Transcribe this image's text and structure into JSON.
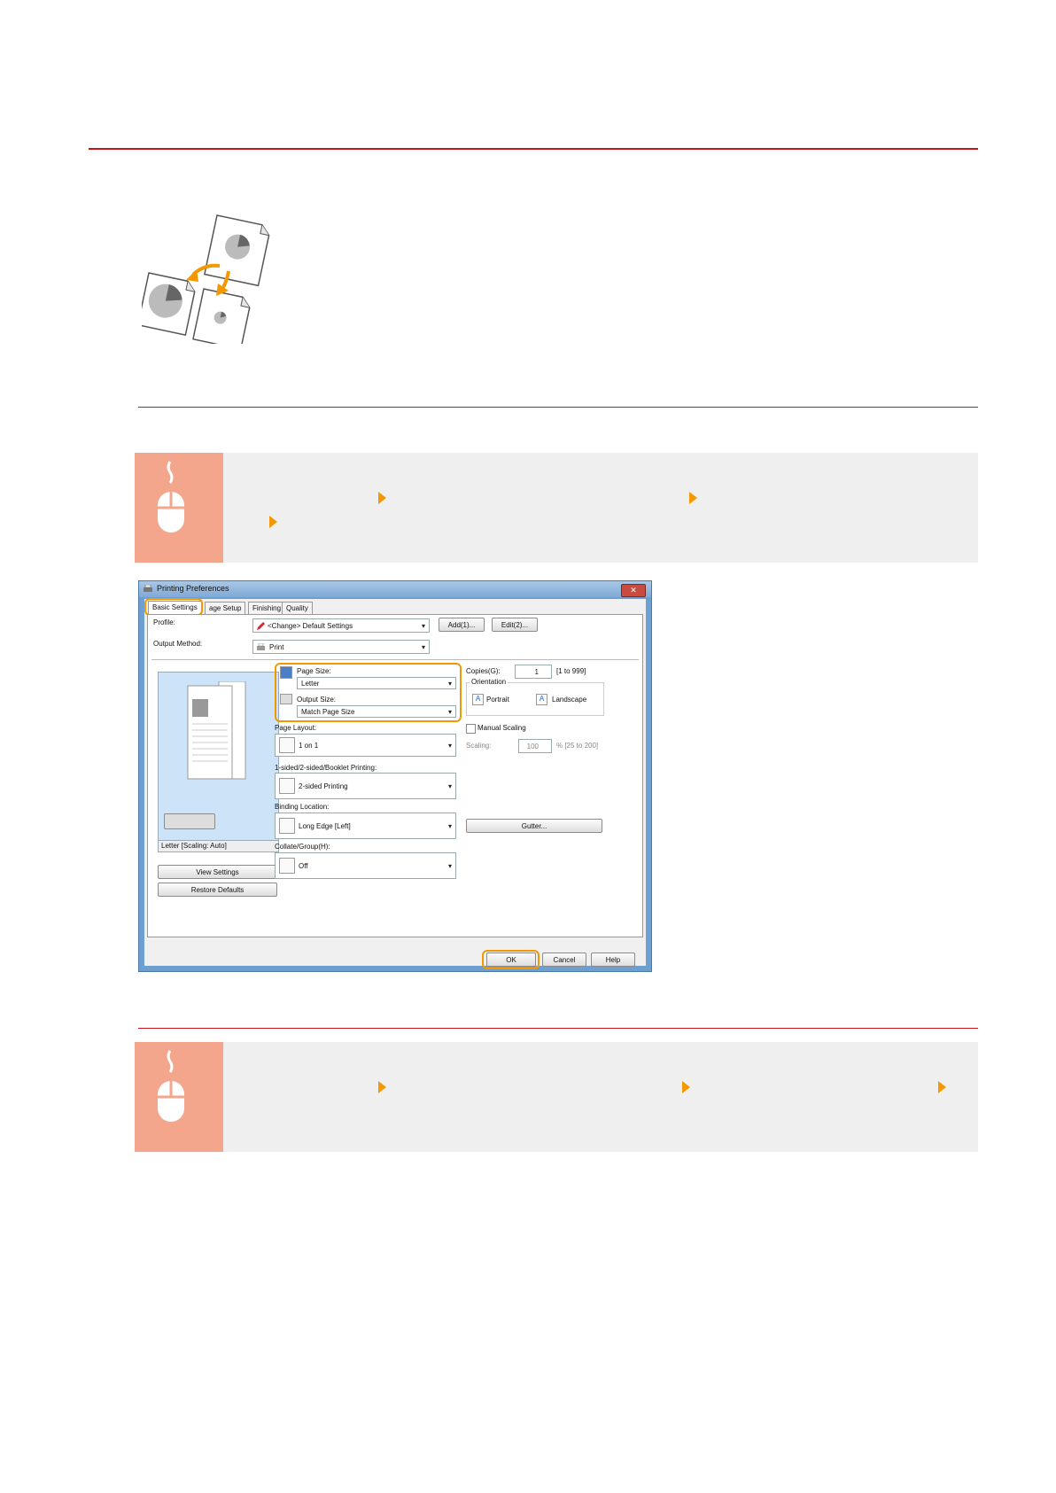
{
  "dialog": {
    "title": "Printing Preferences",
    "close_icon": "close-icon",
    "tabs": [
      "Basic Settings",
      "age Setup",
      "Finishing",
      "Quality"
    ],
    "profile_label": "Profile:",
    "profile_value": "<Change> Default Settings",
    "add_button": "Add(1)...",
    "edit_button": "Edit(2)...",
    "output_method_label": "Output Method:",
    "output_method_value": "Print",
    "page_size_label": "Page Size:",
    "page_size_value": "Letter",
    "output_size_label": "Output Size:",
    "output_size_value": "Match Page Size",
    "copies_label": "Copies(G):",
    "copies_value": "1",
    "copies_range": "[1 to 999]",
    "orientation_label": "Orientation",
    "portrait_label": "Portrait",
    "landscape_label": "Landscape",
    "page_layout_label": "Page Layout:",
    "page_layout_value": "1 on 1",
    "manual_scaling_label": "Manual Scaling",
    "scaling_label": "Scaling:",
    "scaling_value": "100",
    "scaling_range": "% [25 to 200]",
    "sided_label": "1-sided/2-sided/Booklet Printing:",
    "sided_value": "2-sided Printing",
    "binding_label": "Binding Location:",
    "binding_value": "Long Edge [Left]",
    "gutter_button": "Gutter...",
    "collate_label": "Collate/Group(H):",
    "collate_value": "Off",
    "preview_caption": "Letter [Scaling: Auto]",
    "view_settings_button": "View Settings",
    "restore_defaults_button": "Restore Defaults",
    "ok_button": "OK",
    "cancel_button": "Cancel",
    "help_button": "Help"
  },
  "colors": {
    "accent": "#f39800",
    "rule": "#c8161d",
    "procedure_bg": "#efefef",
    "icon_bg": "#f3a68b"
  },
  "icons": [
    "mouse-icon",
    "arrow-icon",
    "paper-scaling-illustration",
    "printer-icon",
    "pencil-icon"
  ]
}
